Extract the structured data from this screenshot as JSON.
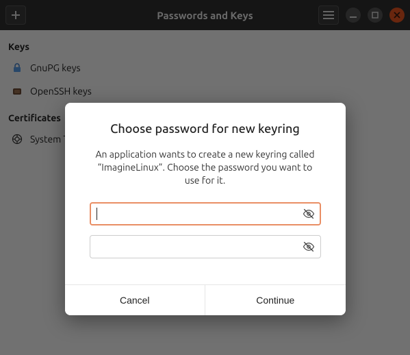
{
  "title": "Passwords and Keys",
  "sections": {
    "keys_header": "Keys",
    "certs_header": "Certificates",
    "items": {
      "gnupg": "GnuPG keys",
      "openssh": "OpenSSH keys",
      "systemtrust": "System Trust"
    }
  },
  "dialog": {
    "title": "Choose password for new keyring",
    "description": "An application wants to create a new keyring called “ImagineLinux”. Choose the password you want to use for it.",
    "password_value": "",
    "confirm_value": "",
    "cancel_label": "Cancel",
    "continue_label": "Continue"
  },
  "colors": {
    "accent": "#e95420",
    "focus_border": "#e98e64"
  }
}
